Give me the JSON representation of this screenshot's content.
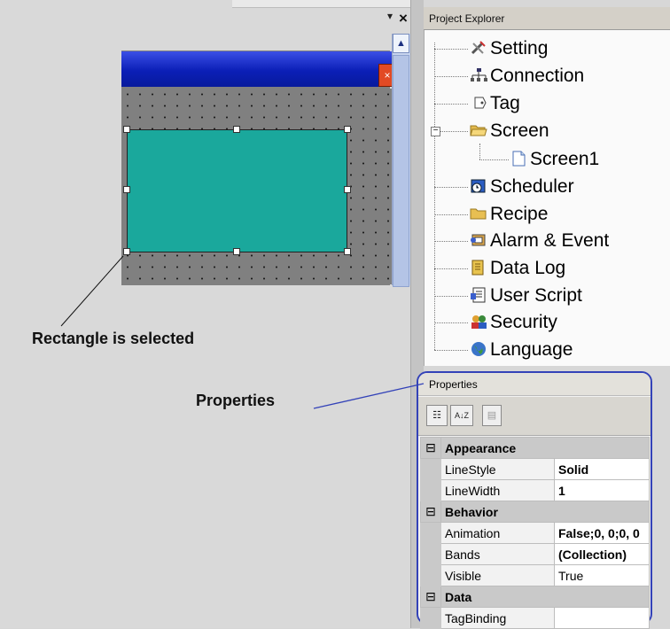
{
  "design": {
    "close_glyph": "×",
    "pin_glyph": "▾",
    "screen_close_glyph": "×",
    "scroll_up_glyph": "▲",
    "shape_fill": "#1aa89c",
    "title_bar_color": "#0b1fb7"
  },
  "explorer": {
    "title": "Project Explorer",
    "expander_glyph": "−",
    "items": [
      {
        "label": "Setting",
        "icon": "tools-icon"
      },
      {
        "label": "Connection",
        "icon": "network-icon"
      },
      {
        "label": "Tag",
        "icon": "tag-icon"
      },
      {
        "label": "Screen",
        "icon": "folder-open-icon"
      },
      {
        "label": "Screen1",
        "icon": "document-icon"
      },
      {
        "label": "Scheduler",
        "icon": "scheduler-icon"
      },
      {
        "label": "Recipe",
        "icon": "folder-icon"
      },
      {
        "label": "Alarm & Event",
        "icon": "alarm-icon"
      },
      {
        "label": "Data Log",
        "icon": "datalog-icon"
      },
      {
        "label": "User Script",
        "icon": "script-icon"
      },
      {
        "label": "Security",
        "icon": "users-icon"
      },
      {
        "label": "Language",
        "icon": "globe-icon"
      }
    ]
  },
  "properties": {
    "title": "Properties",
    "toolbar": {
      "categorized_glyph": "☷",
      "alpha_glyph": "A↓Z",
      "pages_glyph": "▤"
    },
    "categories": [
      {
        "name": "Appearance",
        "toggle": "⊟",
        "rows": [
          {
            "name": "LineStyle",
            "value": "Solid"
          },
          {
            "name": "LineWidth",
            "value": "1"
          }
        ]
      },
      {
        "name": "Behavior",
        "toggle": "⊟",
        "rows": [
          {
            "name": "Animation",
            "value": "False;0, 0;0, 0"
          },
          {
            "name": "Bands",
            "value": "(Collection)"
          },
          {
            "name": "Visible",
            "value": "True"
          }
        ]
      },
      {
        "name": "Data",
        "toggle": "⊟",
        "rows": [
          {
            "name": "TagBinding",
            "value": ""
          }
        ]
      }
    ]
  },
  "annotations": {
    "selected_label": "Rectangle is selected",
    "properties_label": "Properties"
  }
}
